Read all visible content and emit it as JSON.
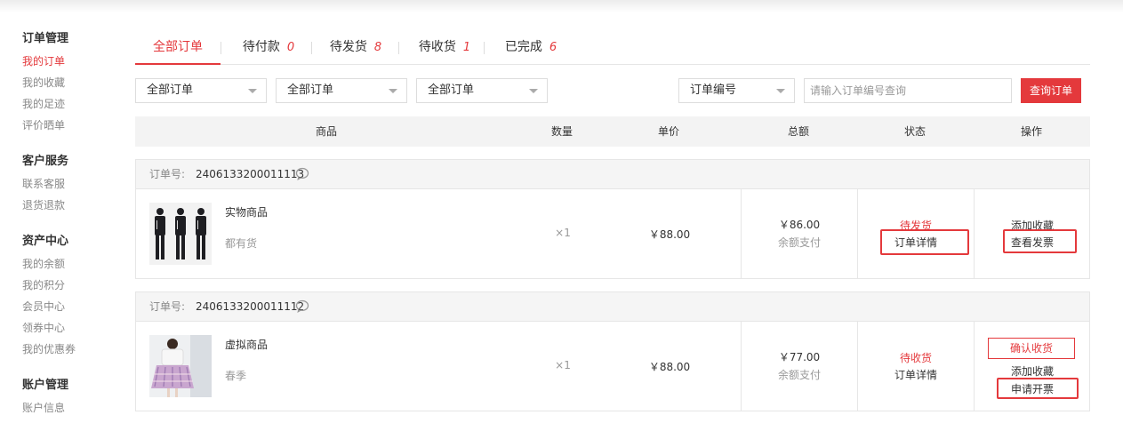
{
  "sidebar": {
    "groups": [
      {
        "title": "订单管理",
        "items": [
          "我的订单",
          "我的收藏",
          "我的足迹",
          "评价晒单"
        ]
      },
      {
        "title": "客户服务",
        "items": [
          "联系客服",
          "退货退款"
        ]
      },
      {
        "title": "资产中心",
        "items": [
          "我的余额",
          "我的积分",
          "会员中心",
          "领券中心",
          "我的优惠券"
        ]
      },
      {
        "title": "账户管理",
        "items": [
          "账户信息"
        ]
      }
    ]
  },
  "tabs": [
    {
      "label": "全部订单",
      "count": ""
    },
    {
      "label": "待付款",
      "count": "0"
    },
    {
      "label": "待发货",
      "count": "8"
    },
    {
      "label": "待收货",
      "count": "1"
    },
    {
      "label": "已完成",
      "count": "6"
    }
  ],
  "filters": {
    "selects": [
      "全部订单",
      "全部订单",
      "全部订单"
    ],
    "search_type": "订单编号",
    "search_placeholder": "请输入订单编号查询",
    "query_button": "查询订单"
  },
  "table_headers": [
    "商品",
    "数量",
    "单价",
    "总额",
    "状态",
    "操作"
  ],
  "orders": [
    {
      "order_label": "订单号:",
      "order_no": "2406133200011113",
      "goods_name": "实物商品",
      "goods_spec": "都有货",
      "qty": "×1",
      "unit_price": "￥88.00",
      "total": "￥86.00",
      "pay_method": "余额支付",
      "status": "待发货",
      "detail": "订单详情",
      "actions": [
        "添加收藏",
        "查看发票"
      ]
    },
    {
      "order_label": "订单号:",
      "order_no": "2406133200011112",
      "goods_name": "虚拟商品",
      "goods_spec": "春季",
      "qty": "×1",
      "unit_price": "￥88.00",
      "total": "￥77.00",
      "pay_method": "余额支付",
      "status": "待收货",
      "detail": "订单详情",
      "confirm": "确认收货",
      "actions": [
        "添加收藏",
        "申请开票"
      ]
    }
  ],
  "colors": {
    "accent": "#e4393c",
    "header_bg": "#f3f3f3",
    "border": "#e6e6e6"
  },
  "icons": {
    "order_head": "chat-bubble-icon",
    "select": "caret-down-icon"
  }
}
